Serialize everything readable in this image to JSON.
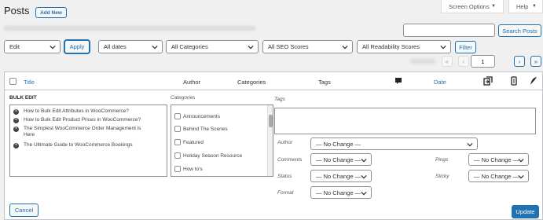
{
  "header": {
    "title": "Posts",
    "add_new": "Add New",
    "screen_options": "Screen Options",
    "help": "Help"
  },
  "search": {
    "value": "",
    "button": "Search Posts"
  },
  "filters": {
    "bulk_action": "Edit",
    "apply": "Apply",
    "dates": "All dates",
    "categories": "All Categories",
    "seo": "All SEO Scores",
    "readability": "All Readability Scores",
    "filter": "Filter"
  },
  "pagination": {
    "first": "«",
    "prev": "‹",
    "current_page": "1",
    "next": "›",
    "last": "»"
  },
  "columns": {
    "title": "Title",
    "author": "Author",
    "categories": "Categories",
    "tags": "Tags",
    "date": "Date"
  },
  "bulk_edit": {
    "heading": "BULK EDIT",
    "posts": [
      "How to Bulk Edit Attributes in WooCommerce?",
      "How to Bulk Edit Product Prices in WooCommerce?",
      "The Simplest WooCommerce Order Management is Here",
      "The Ultimate Guide to WooCommerce Bookings"
    ],
    "categories_label": "Categories",
    "categories": [
      "Announcements",
      "Behind The Scenes",
      "Featured",
      "Holiday Season Resource",
      "How to's"
    ],
    "tags_label": "Tags",
    "author_label": "Author",
    "author_value": "— No Change —",
    "comments_label": "Comments",
    "comments_value": "— No Change —",
    "status_label": "Status",
    "status_value": "— No Change —",
    "format_label": "Format",
    "format_value": "— No Change —",
    "pings_label": "Pings",
    "pings_value": "— No Change —",
    "sticky_label": "Sticky",
    "sticky_value": "— No Change —",
    "cancel": "Cancel",
    "update": "Update"
  },
  "colors": {
    "accent": "#2271b1",
    "background": "#f0f0f1",
    "border": "#c3c4c7"
  }
}
